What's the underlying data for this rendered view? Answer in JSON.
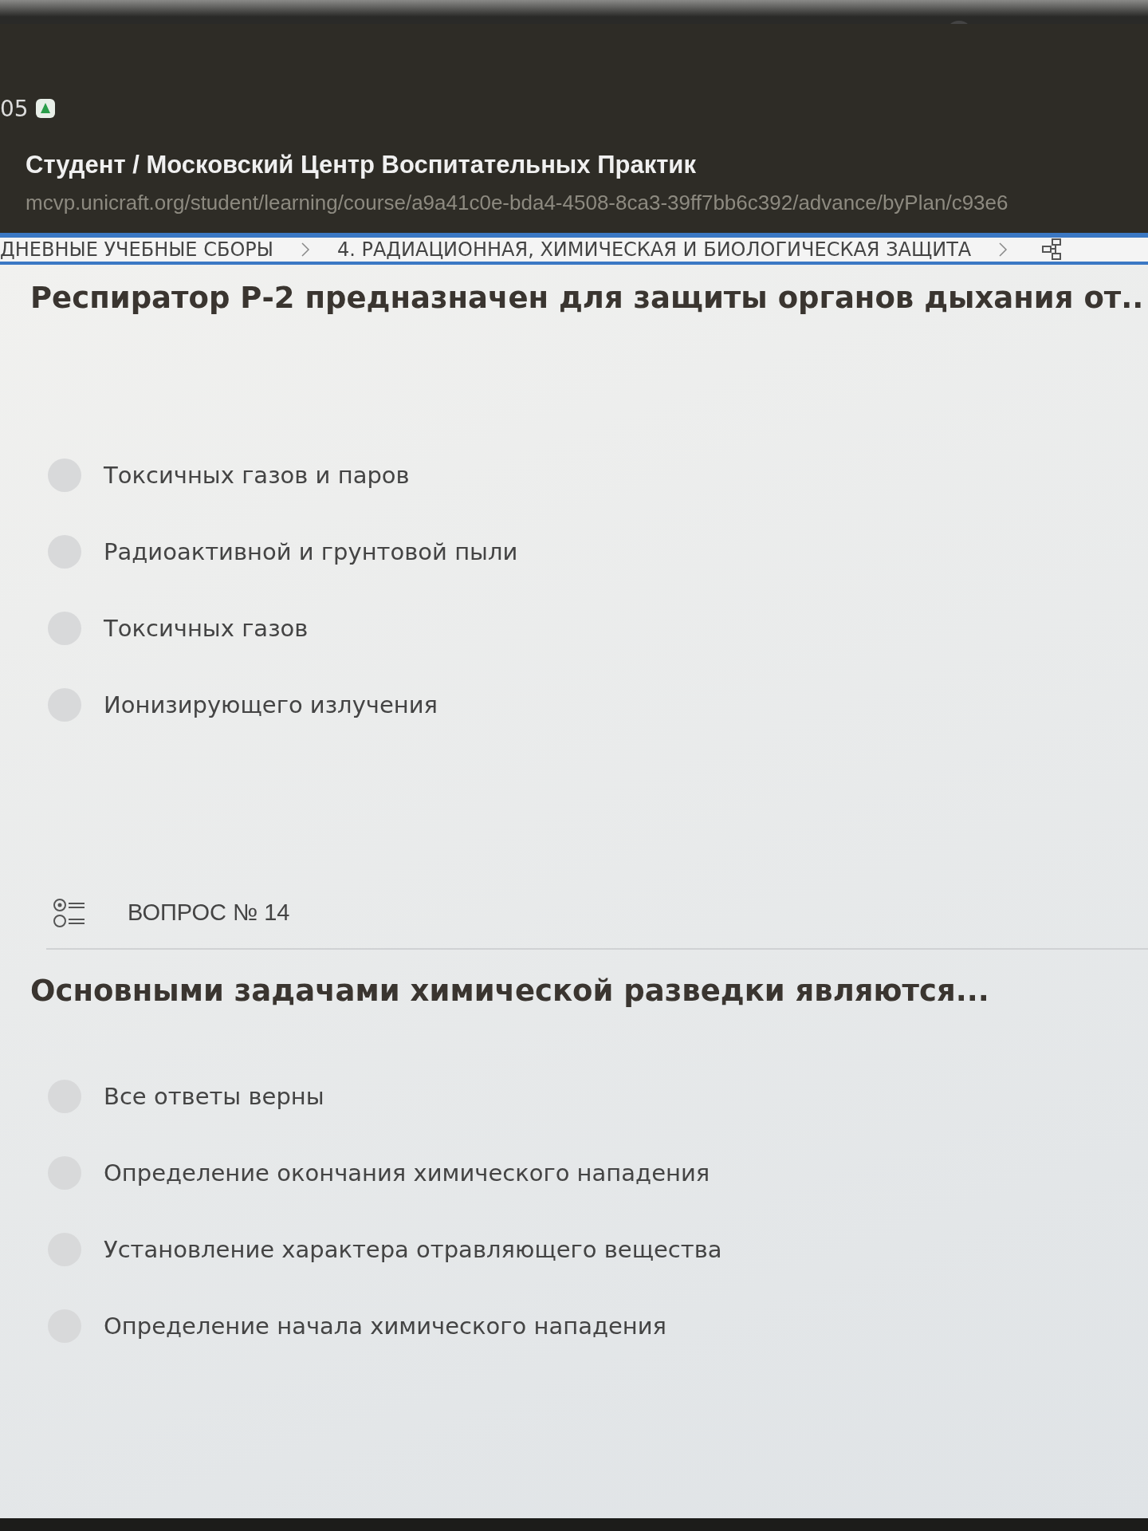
{
  "status_bar": {
    "time": "05"
  },
  "page": {
    "title": "Студент / Московский Центр Воспитательных Практик",
    "url": "mcvp.unicraft.org/student/learning/course/a9a41c0e-bda4-4508-8ca3-39ff7bb6c392/advance/byPlan/c93e6"
  },
  "breadcrumbs": [
    {
      "label": "ДНЕВНЫЕ УЧЕБНЫЕ СБОРЫ"
    },
    {
      "label": "4. РАДИАЦИОННАЯ, ХИМИЧЕСКАЯ И БИОЛОГИЧЕСКАЯ ЗАЩИТА"
    }
  ],
  "questions": [
    {
      "title": "Респиратор Р-2 предназначен для защиты органов дыхания от..",
      "options": [
        {
          "label": "Токсичных газов и паров",
          "selected": false
        },
        {
          "label": "Радиоактивной и грунтовой пыли",
          "selected": false
        },
        {
          "label": "Токсичных газов",
          "selected": false
        },
        {
          "label": "Ионизирующего излучения",
          "selected": false
        }
      ]
    },
    {
      "number": "ВОПРОС № 14",
      "title": "Основными задачами химической разведки являются...",
      "options": [
        {
          "label": "Все ответы верны",
          "selected": false
        },
        {
          "label": "Определение окончания химического нападения",
          "selected": false
        },
        {
          "label": "Установление характера отравляющего вещества",
          "selected": false
        },
        {
          "label": "Определение начала химического нападения",
          "selected": false
        }
      ]
    }
  ]
}
